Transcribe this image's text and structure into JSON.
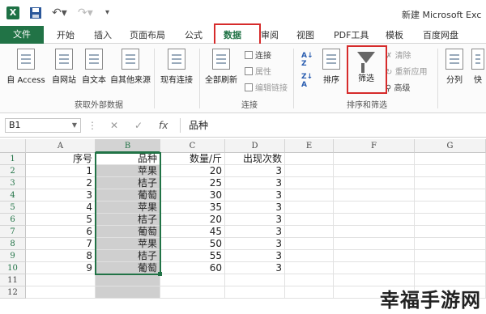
{
  "window": {
    "title": "新建 Microsoft Exc",
    "app_icon": "X"
  },
  "tabs": {
    "file": "文件",
    "home": "开始",
    "insert": "插入",
    "page_layout": "页面布局",
    "formulas": "公式",
    "data": "数据",
    "review": "审阅",
    "view": "视图",
    "pdf_tools": "PDF工具",
    "template": "模板",
    "baidu_disk": "百度网盘"
  },
  "ribbon": {
    "external": {
      "access": "自 Access",
      "web": "自网站",
      "text": "自文本",
      "other": "自其他来源",
      "existing": "现有连接",
      "group_label": "获取外部数据"
    },
    "connections": {
      "refresh_all": "全部刷新",
      "connect": "连接",
      "properties": "属性",
      "edit_links": "编辑链接",
      "group_label": "连接"
    },
    "sort_filter": {
      "sort": "排序",
      "filter": "筛选",
      "clear": "清除",
      "reapply": "重新应用",
      "advanced": "高级",
      "group_label": "排序和筛选"
    },
    "tools": {
      "split": "分列",
      "fast": "快"
    }
  },
  "formula_bar": {
    "name_box": "B1",
    "fx": "fx",
    "content": "品种"
  },
  "columns": [
    "A",
    "B",
    "C",
    "D",
    "E",
    "F",
    "G"
  ],
  "rows": [
    "1",
    "2",
    "3",
    "4",
    "5",
    "6",
    "7",
    "8",
    "9",
    "10",
    "11",
    "12"
  ],
  "table": [
    [
      "序号",
      "品种",
      "数量/斤",
      "出现次数"
    ],
    [
      "1",
      "苹果",
      "20",
      "3"
    ],
    [
      "2",
      "桔子",
      "25",
      "3"
    ],
    [
      "3",
      "葡萄",
      "30",
      "3"
    ],
    [
      "4",
      "苹果",
      "35",
      "3"
    ],
    [
      "5",
      "桔子",
      "20",
      "3"
    ],
    [
      "6",
      "葡萄",
      "45",
      "3"
    ],
    [
      "7",
      "苹果",
      "50",
      "3"
    ],
    [
      "8",
      "桔子",
      "55",
      "3"
    ],
    [
      "9",
      "葡萄",
      "60",
      "3"
    ]
  ],
  "watermark": "幸福手游网",
  "colors": {
    "excel_green": "#217346",
    "highlight_red": "#d62b2b"
  }
}
